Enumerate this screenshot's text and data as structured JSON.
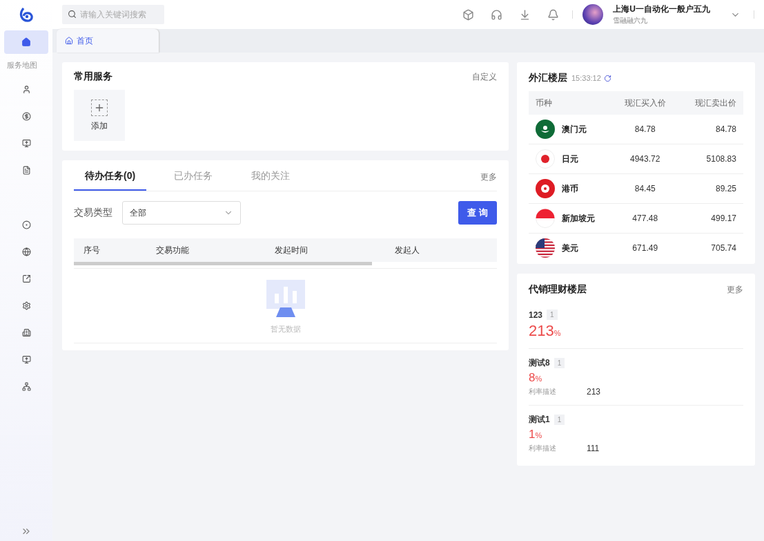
{
  "header": {
    "search": {
      "placeholder": "请输入关键词搜索"
    },
    "user": {
      "name": "上海U一自动化一般户五九",
      "subtitle": "雪融融六九"
    }
  },
  "sidebar": {
    "items": [
      {
        "selected": true
      },
      {
        "selected": false
      },
      {
        "selected": false
      },
      {
        "selected": false
      },
      {
        "selected": false
      },
      {
        "selected": false
      },
      {
        "selected": false
      },
      {
        "selected": false
      },
      {
        "selected": false
      },
      {
        "selected": false
      },
      {
        "selected": false
      },
      {
        "selected": false
      }
    ],
    "section_label": "服务地图"
  },
  "page_tabs": [
    {
      "label": "首页",
      "selected": true
    }
  ],
  "services": {
    "title": "常用服务",
    "action": "自定义",
    "items": [
      {
        "label": "添加"
      }
    ]
  },
  "tasks": {
    "tabs": [
      {
        "label": "待办任务(0)",
        "selected": true
      },
      {
        "label": "已办任务",
        "selected": false
      },
      {
        "label": "我的关注",
        "selected": false
      }
    ],
    "more": "更多",
    "filter": {
      "label": "交易类型",
      "value": "全部"
    },
    "query_button": "查 询",
    "columns": [
      "序号",
      "交易功能",
      "发起时间",
      "发起人"
    ],
    "empty_text": "暂无数据"
  },
  "forex": {
    "title": "外汇楼层",
    "time": "15:33:12",
    "columns": [
      "币种",
      "现汇买入价",
      "现汇卖出价"
    ],
    "rows": [
      {
        "currency": "澳门元",
        "buy": "84.78",
        "sell": "84.78"
      },
      {
        "currency": "日元",
        "buy": "4943.72",
        "sell": "5108.83"
      },
      {
        "currency": "港币",
        "buy": "84.45",
        "sell": "89.25"
      },
      {
        "currency": "新加坡元",
        "buy": "477.48",
        "sell": "499.17"
      },
      {
        "currency": "美元",
        "buy": "671.49",
        "sell": "705.74"
      }
    ]
  },
  "wealth": {
    "title": "代销理财楼层",
    "more": "更多",
    "items": [
      {
        "name": "123",
        "badge": "1",
        "rate": "213",
        "unit": "%"
      },
      {
        "name": "测试8",
        "badge": "1",
        "rate": "8",
        "unit": "%",
        "desc_label": "利率描述",
        "desc_value": "213"
      },
      {
        "name": "测试1",
        "badge": "1",
        "rate": "1",
        "unit": "%",
        "desc_label": "利率描述",
        "desc_value": "111"
      }
    ]
  }
}
